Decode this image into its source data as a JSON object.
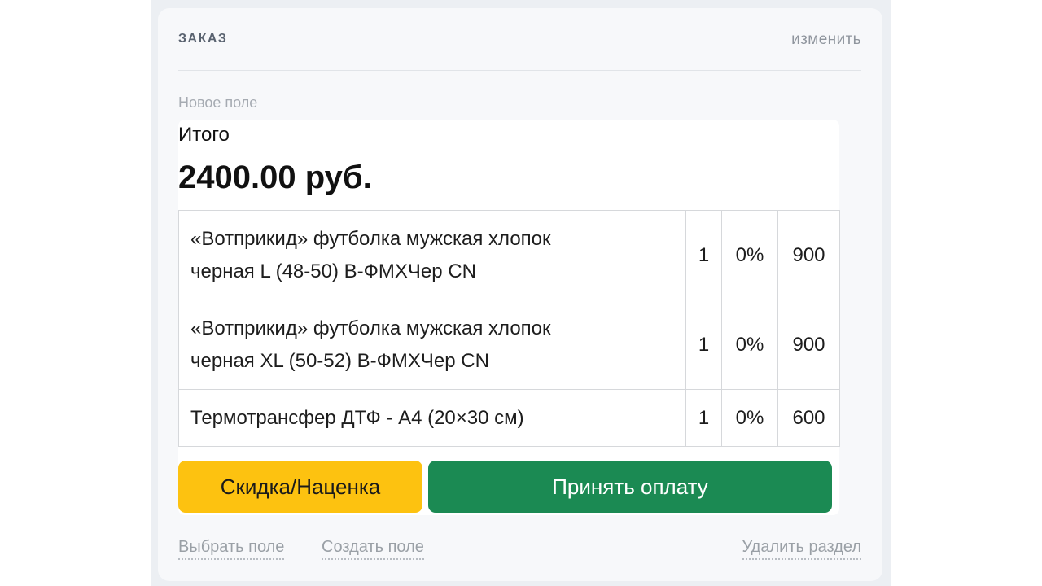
{
  "section": {
    "title": "ЗАКАЗ",
    "edit_label": "изменить"
  },
  "field": {
    "label": "Новое поле",
    "total_label": "Итого",
    "total_value": "2400.00 руб."
  },
  "items": [
    {
      "name_line1": "«Вотприкид» футболка мужская хлопок",
      "name_line2": "черная L (48-50) В-ФМХЧер CN",
      "qty": "1",
      "discount": "0%",
      "sum": "900"
    },
    {
      "name_line1": "«Вотприкид» футболка мужская хлопок",
      "name_line2": "черная XL (50-52) В-ФМХЧер CN",
      "qty": "1",
      "discount": "0%",
      "sum": "900"
    },
    {
      "name_line1": "Термотрансфер ДТФ - А4 (20×30 см)",
      "qty": "1",
      "discount": "0%",
      "sum": "600"
    }
  ],
  "buttons": {
    "discount_label": "Скидка/Наценка",
    "pay_label": "Принять оплату"
  },
  "footer": {
    "select_field": "Выбрать поле",
    "create_field": "Создать поле",
    "delete_section": "Удалить раздел"
  },
  "colors": {
    "discount_button": "#fdc210",
    "pay_button": "#1b8a53",
    "card_background": "#f7f8fa"
  }
}
